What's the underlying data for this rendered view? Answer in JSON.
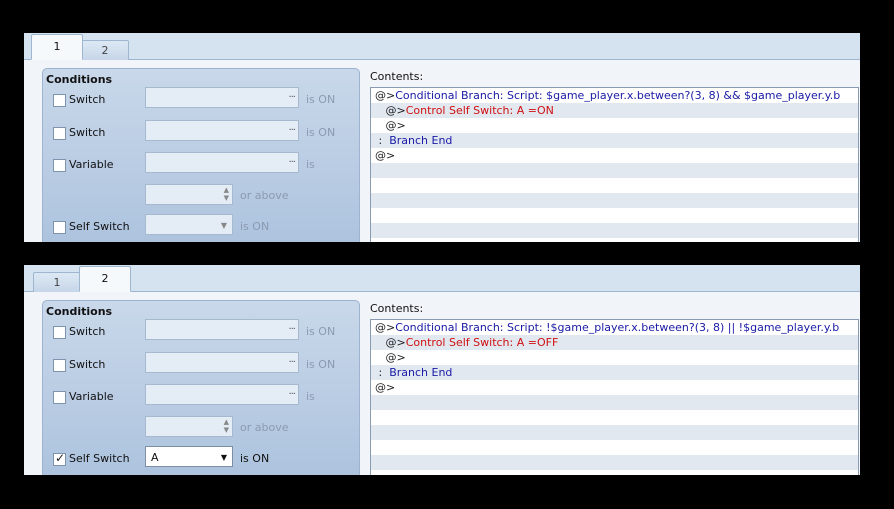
{
  "panels": [
    {
      "tabs": [
        {
          "label": "1"
        },
        {
          "label": "2"
        }
      ],
      "active_tab": 0,
      "conditions": {
        "title": "Conditions",
        "switch1": {
          "label": "Switch",
          "suffix": "is ON"
        },
        "switch2": {
          "label": "Switch",
          "suffix": "is ON"
        },
        "variable": {
          "label": "Variable",
          "suffix": "is",
          "above": "or above"
        },
        "self_switch": {
          "label": "Self Switch",
          "value": "",
          "suffix": "is ON",
          "checked": false
        }
      },
      "contents_label": "Contents:",
      "contents": [
        {
          "prefix": "@>",
          "text": "Conditional Branch: Script: $game_player.x.between?(3, 8) && $game_player.y.b",
          "color": "blue"
        },
        {
          "prefix": "   @>",
          "text": "Control Self Switch: A =ON",
          "color": "red"
        },
        {
          "prefix": "   @>",
          "text": "",
          "color": "blue"
        },
        {
          "prefix": " :  ",
          "text": "Branch End",
          "color": "blue"
        },
        {
          "prefix": "@>",
          "text": "",
          "color": "blue"
        }
      ]
    },
    {
      "tabs": [
        {
          "label": "1"
        },
        {
          "label": "2"
        }
      ],
      "active_tab": 1,
      "conditions": {
        "title": "Conditions",
        "switch1": {
          "label": "Switch",
          "suffix": "is ON"
        },
        "switch2": {
          "label": "Switch",
          "suffix": "is ON"
        },
        "variable": {
          "label": "Variable",
          "suffix": "is",
          "above": "or above"
        },
        "self_switch": {
          "label": "Self Switch",
          "value": "A",
          "suffix": "is ON",
          "checked": true
        }
      },
      "contents_label": "Contents:",
      "contents": [
        {
          "prefix": "@>",
          "text": "Conditional Branch: Script: !$game_player.x.between?(3, 8) || !$game_player.y.b",
          "color": "blue"
        },
        {
          "prefix": "   @>",
          "text": "Control Self Switch: A =OFF",
          "color": "red"
        },
        {
          "prefix": "   @>",
          "text": "",
          "color": "blue"
        },
        {
          "prefix": " :  ",
          "text": "Branch End",
          "color": "blue"
        },
        {
          "prefix": "@>",
          "text": "",
          "color": "blue"
        }
      ]
    }
  ]
}
